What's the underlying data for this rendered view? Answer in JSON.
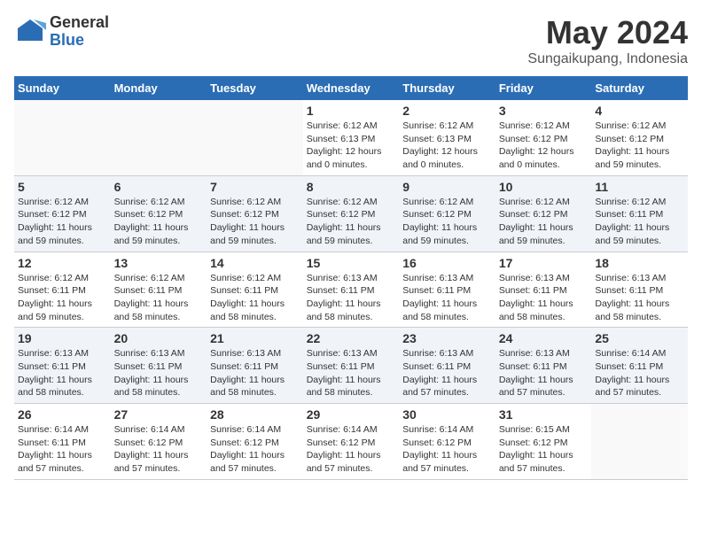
{
  "header": {
    "logo_general": "General",
    "logo_blue": "Blue",
    "title": "May 2024",
    "subtitle": "Sungaikupang, Indonesia"
  },
  "days_of_week": [
    "Sunday",
    "Monday",
    "Tuesday",
    "Wednesday",
    "Thursday",
    "Friday",
    "Saturday"
  ],
  "weeks": [
    {
      "days": [
        {
          "num": "",
          "info": ""
        },
        {
          "num": "",
          "info": ""
        },
        {
          "num": "",
          "info": ""
        },
        {
          "num": "1",
          "info": "Sunrise: 6:12 AM\nSunset: 6:13 PM\nDaylight: 12 hours\nand 0 minutes."
        },
        {
          "num": "2",
          "info": "Sunrise: 6:12 AM\nSunset: 6:13 PM\nDaylight: 12 hours\nand 0 minutes."
        },
        {
          "num": "3",
          "info": "Sunrise: 6:12 AM\nSunset: 6:12 PM\nDaylight: 12 hours\nand 0 minutes."
        },
        {
          "num": "4",
          "info": "Sunrise: 6:12 AM\nSunset: 6:12 PM\nDaylight: 11 hours\nand 59 minutes."
        }
      ]
    },
    {
      "days": [
        {
          "num": "5",
          "info": "Sunrise: 6:12 AM\nSunset: 6:12 PM\nDaylight: 11 hours\nand 59 minutes."
        },
        {
          "num": "6",
          "info": "Sunrise: 6:12 AM\nSunset: 6:12 PM\nDaylight: 11 hours\nand 59 minutes."
        },
        {
          "num": "7",
          "info": "Sunrise: 6:12 AM\nSunset: 6:12 PM\nDaylight: 11 hours\nand 59 minutes."
        },
        {
          "num": "8",
          "info": "Sunrise: 6:12 AM\nSunset: 6:12 PM\nDaylight: 11 hours\nand 59 minutes."
        },
        {
          "num": "9",
          "info": "Sunrise: 6:12 AM\nSunset: 6:12 PM\nDaylight: 11 hours\nand 59 minutes."
        },
        {
          "num": "10",
          "info": "Sunrise: 6:12 AM\nSunset: 6:12 PM\nDaylight: 11 hours\nand 59 minutes."
        },
        {
          "num": "11",
          "info": "Sunrise: 6:12 AM\nSunset: 6:11 PM\nDaylight: 11 hours\nand 59 minutes."
        }
      ]
    },
    {
      "days": [
        {
          "num": "12",
          "info": "Sunrise: 6:12 AM\nSunset: 6:11 PM\nDaylight: 11 hours\nand 59 minutes."
        },
        {
          "num": "13",
          "info": "Sunrise: 6:12 AM\nSunset: 6:11 PM\nDaylight: 11 hours\nand 58 minutes."
        },
        {
          "num": "14",
          "info": "Sunrise: 6:12 AM\nSunset: 6:11 PM\nDaylight: 11 hours\nand 58 minutes."
        },
        {
          "num": "15",
          "info": "Sunrise: 6:13 AM\nSunset: 6:11 PM\nDaylight: 11 hours\nand 58 minutes."
        },
        {
          "num": "16",
          "info": "Sunrise: 6:13 AM\nSunset: 6:11 PM\nDaylight: 11 hours\nand 58 minutes."
        },
        {
          "num": "17",
          "info": "Sunrise: 6:13 AM\nSunset: 6:11 PM\nDaylight: 11 hours\nand 58 minutes."
        },
        {
          "num": "18",
          "info": "Sunrise: 6:13 AM\nSunset: 6:11 PM\nDaylight: 11 hours\nand 58 minutes."
        }
      ]
    },
    {
      "days": [
        {
          "num": "19",
          "info": "Sunrise: 6:13 AM\nSunset: 6:11 PM\nDaylight: 11 hours\nand 58 minutes."
        },
        {
          "num": "20",
          "info": "Sunrise: 6:13 AM\nSunset: 6:11 PM\nDaylight: 11 hours\nand 58 minutes."
        },
        {
          "num": "21",
          "info": "Sunrise: 6:13 AM\nSunset: 6:11 PM\nDaylight: 11 hours\nand 58 minutes."
        },
        {
          "num": "22",
          "info": "Sunrise: 6:13 AM\nSunset: 6:11 PM\nDaylight: 11 hours\nand 58 minutes."
        },
        {
          "num": "23",
          "info": "Sunrise: 6:13 AM\nSunset: 6:11 PM\nDaylight: 11 hours\nand 57 minutes."
        },
        {
          "num": "24",
          "info": "Sunrise: 6:13 AM\nSunset: 6:11 PM\nDaylight: 11 hours\nand 57 minutes."
        },
        {
          "num": "25",
          "info": "Sunrise: 6:14 AM\nSunset: 6:11 PM\nDaylight: 11 hours\nand 57 minutes."
        }
      ]
    },
    {
      "days": [
        {
          "num": "26",
          "info": "Sunrise: 6:14 AM\nSunset: 6:11 PM\nDaylight: 11 hours\nand 57 minutes."
        },
        {
          "num": "27",
          "info": "Sunrise: 6:14 AM\nSunset: 6:12 PM\nDaylight: 11 hours\nand 57 minutes."
        },
        {
          "num": "28",
          "info": "Sunrise: 6:14 AM\nSunset: 6:12 PM\nDaylight: 11 hours\nand 57 minutes."
        },
        {
          "num": "29",
          "info": "Sunrise: 6:14 AM\nSunset: 6:12 PM\nDaylight: 11 hours\nand 57 minutes."
        },
        {
          "num": "30",
          "info": "Sunrise: 6:14 AM\nSunset: 6:12 PM\nDaylight: 11 hours\nand 57 minutes."
        },
        {
          "num": "31",
          "info": "Sunrise: 6:15 AM\nSunset: 6:12 PM\nDaylight: 11 hours\nand 57 minutes."
        },
        {
          "num": "",
          "info": ""
        }
      ]
    }
  ]
}
